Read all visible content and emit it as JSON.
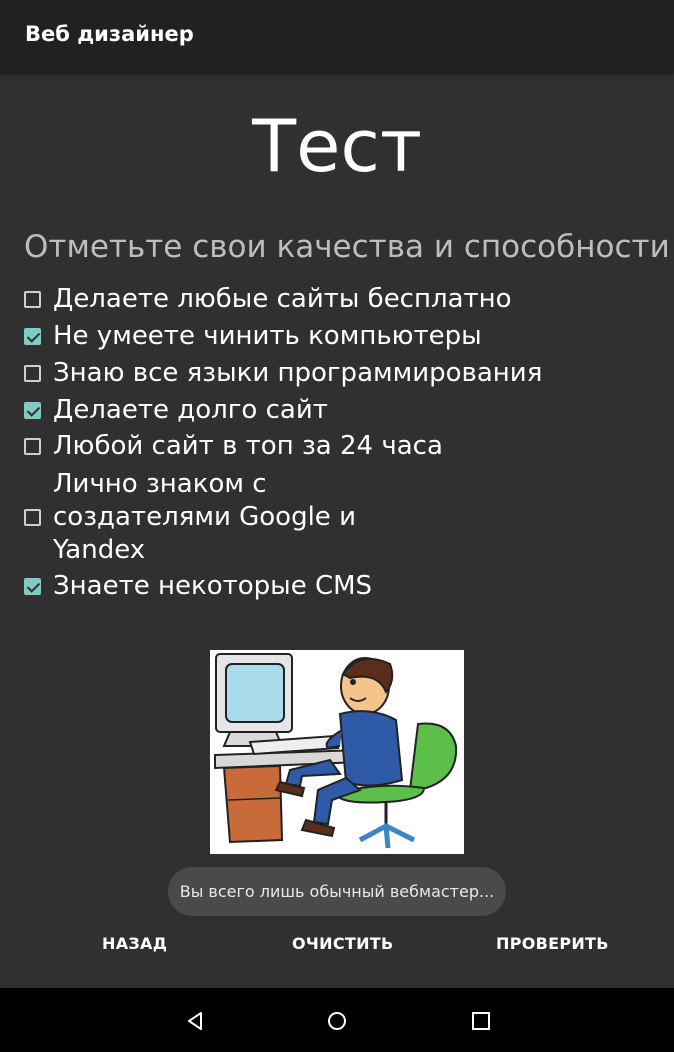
{
  "app": {
    "title": "Веб дизайнер"
  },
  "main": {
    "heading": "Тест",
    "subheading": "Отметьте свои качества и способности",
    "checkboxes": [
      {
        "label": "Делаете любые сайты бесплатно",
        "checked": false
      },
      {
        "label": "Не умеете чинить компьютеры",
        "checked": true
      },
      {
        "label": "Знаю все языки программирования",
        "checked": false
      },
      {
        "label": "Делаете долго сайт",
        "checked": true
      },
      {
        "label": "Любой сайт в топ за 24 часа",
        "checked": false
      },
      {
        "label": "Лично знаком с создателями Google и Yandex",
        "checked": false
      },
      {
        "label": "Знаете некоторые CMS",
        "checked": true
      }
    ],
    "illustration": "person-at-computer-illustration"
  },
  "toast": {
    "text": "Вы всего лишь обычный вебмастер..."
  },
  "actions": {
    "back": "НАЗАД",
    "clear": "ОЧИСТИТЬ",
    "check": "ПРОВЕРИТЬ"
  },
  "navbar": {
    "icons": [
      "back-triangle-icon",
      "home-circle-icon",
      "recents-square-icon"
    ]
  },
  "colors": {
    "background": "#303030",
    "appbar": "#212121",
    "accent": "#80cbc4"
  }
}
